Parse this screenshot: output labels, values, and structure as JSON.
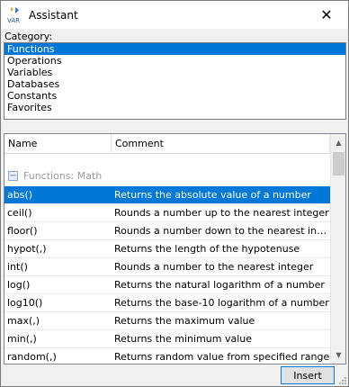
{
  "window": {
    "title": "Assistant",
    "icon": "var-icon",
    "close_glyph": "✕"
  },
  "category": {
    "label": "Category:",
    "items": [
      "Functions",
      "Operations",
      "Variables",
      "Databases",
      "Constants",
      "Favorites"
    ],
    "selected_index": 0
  },
  "table": {
    "columns": [
      "Name",
      "Comment"
    ],
    "group": {
      "toggle_glyph": "−",
      "label": "Functions: Math"
    },
    "rows": [
      {
        "name": "abs()",
        "comment": "Returns the absolute value of a number"
      },
      {
        "name": "ceil()",
        "comment": "Rounds a number up to the nearest integer"
      },
      {
        "name": "floor()",
        "comment": "Rounds a number down to the nearest inte..."
      },
      {
        "name": "hypot(,)",
        "comment": "Returns the length of the hypotenuse"
      },
      {
        "name": "int()",
        "comment": "Rounds a number to the nearest integer"
      },
      {
        "name": "log()",
        "comment": "Returns the natural logarithm of a number"
      },
      {
        "name": "log10()",
        "comment": "Returns the base-10 logarithm of a number"
      },
      {
        "name": "max(,)",
        "comment": "Returns the maximum value"
      },
      {
        "name": "min(,)",
        "comment": "Returns the minimum value"
      },
      {
        "name": "random(,)",
        "comment": "Returns random value from specified range"
      }
    ],
    "selected_index": 0
  },
  "scroll": {
    "up_glyph": "▲",
    "down_glyph": "▼"
  },
  "buttons": {
    "insert": "Insert"
  },
  "colors": {
    "selection": "#0078d7",
    "group_label": "#9a9a9a"
  }
}
